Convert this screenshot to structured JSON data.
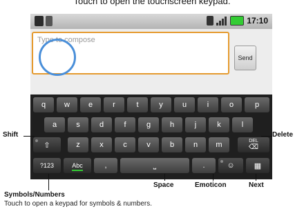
{
  "top_caption": "Touch to open the touchscreen keypad.",
  "status_bar": {
    "time": "17:10",
    "icons": [
      "usb-icon",
      "sd-card-icon",
      "sim-icon",
      "signal-icon",
      "battery-icon"
    ]
  },
  "compose": {
    "placeholder": "Type to compose",
    "send_label": "Send"
  },
  "keyboard": {
    "row1": [
      "q",
      "w",
      "e",
      "r",
      "t",
      "y",
      "u",
      "i",
      "o",
      "p"
    ],
    "row2": [
      "a",
      "s",
      "d",
      "f",
      "g",
      "h",
      "j",
      "k",
      "l"
    ],
    "row3": [
      "z",
      "x",
      "c",
      "v",
      "b",
      "n",
      "m"
    ],
    "shift_label": "⇧",
    "delete_label": "DEL",
    "symbols_label": "?123",
    "abc_label": "Abc",
    "comma_label": ",",
    "space_label": "⎵",
    "period_label": ".",
    "emoticon_label": "☺",
    "next_label": "▦"
  },
  "annotations": {
    "shift": "Shift",
    "delete": "Delete",
    "symbols_numbers": "Symbols/Numbers",
    "space": "Space",
    "emoticon": "Emoticon",
    "next": "Next"
  },
  "bottom_caption": "Touch to open a keypad for symbols & numbers."
}
